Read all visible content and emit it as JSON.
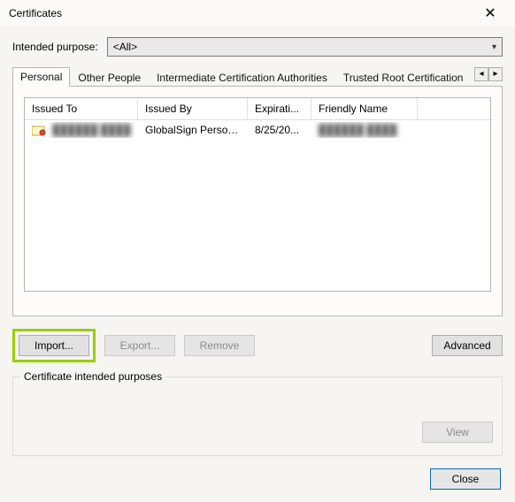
{
  "window": {
    "title": "Certificates",
    "close_aria": "Close"
  },
  "purpose": {
    "label": "Intended purpose:",
    "selected": "<All>"
  },
  "tabs": {
    "items": [
      {
        "label": "Personal"
      },
      {
        "label": "Other People"
      },
      {
        "label": "Intermediate Certification Authorities"
      },
      {
        "label": "Trusted Root Certification"
      }
    ],
    "active_index": 0
  },
  "listview": {
    "columns": [
      {
        "label": "Issued To"
      },
      {
        "label": "Issued By"
      },
      {
        "label": "Expirati..."
      },
      {
        "label": "Friendly Name"
      }
    ],
    "rows": [
      {
        "issued_to": "██████ ████",
        "issued_by": "GlobalSign Person...",
        "expiration": "8/25/20...",
        "friendly_name": "██████ ████"
      }
    ]
  },
  "buttons": {
    "import": "Import...",
    "export": "Export...",
    "remove": "Remove",
    "advanced": "Advanced",
    "view": "View",
    "close": "Close"
  },
  "groupbox": {
    "legend": "Certificate intended purposes"
  },
  "icons": {
    "cert": "certificate-icon",
    "chevron_down": "▾",
    "tab_left": "◂",
    "tab_right": "▸",
    "close_x": "✕"
  }
}
